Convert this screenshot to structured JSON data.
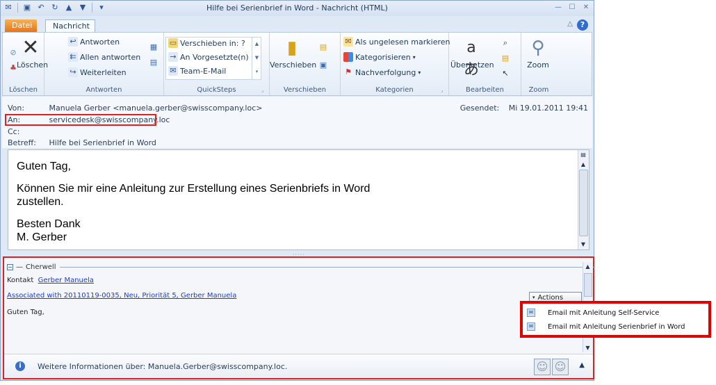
{
  "window": {
    "title": "Hilfe bei Serienbrief in Word - Nachricht (HTML)"
  },
  "tabs": {
    "file": "Datei",
    "message": "Nachricht"
  },
  "ribbon": {
    "delete": {
      "button": "Löschen",
      "group": "Löschen"
    },
    "respond": {
      "reply": "Antworten",
      "reply_all": "Allen antworten",
      "forward": "Weiterleiten",
      "group": "Antworten"
    },
    "quicksteps": {
      "move_to": "Verschieben in: ?",
      "to_manager": "An Vorgesetzte(n)",
      "team_email": "Team-E-Mail",
      "group": "QuickSteps"
    },
    "move": {
      "button": "Verschieben",
      "group": "Verschieben"
    },
    "tags": {
      "mark_unread": "Als ungelesen markieren",
      "categorize": "Kategorisieren",
      "follow_up": "Nachverfolgung",
      "group": "Kategorien"
    },
    "editing": {
      "translate": "Übersetzen",
      "group": "Bearbeiten"
    },
    "zoom": {
      "button": "Zoom",
      "group": "Zoom"
    }
  },
  "header": {
    "from_label": "Von:",
    "from_value": "Manuela Gerber <manuela.gerber@swisscompany.loc>",
    "to_label": "An:",
    "to_value": "servicedesk@swisscompany.loc",
    "cc_label": "Cc:",
    "subject_label": "Betreff:",
    "subject_value": "Hilfe bei Serienbrief in Word",
    "sent_label": "Gesendet:",
    "sent_value": "Mi 19.01.2011 19:41"
  },
  "body": {
    "greeting": "Guten Tag,",
    "line1": "Können Sie mir eine Anleitung zur Erstellung eines Serienbriefs in Word",
    "line2": "zustellen.",
    "closing1": "Besten Dank",
    "closing2": "M. Gerber"
  },
  "addin": {
    "title": "Cherwell",
    "contact_label": "Kontakt",
    "contact_link": "Gerber Manuela",
    "associated_link": "Associated with 20110119-0035, Neu, Priorität 5, Gerber Manuela",
    "actions_button": "Actions",
    "preview": "Guten Tag,",
    "menu_items": [
      "Email mit Anleitung Self-Service",
      "Email mit Anleitung Serienbrief in Word"
    ]
  },
  "people_pane": {
    "info": "Weitere Informationen über: Manuela.Gerber@swisscompany.loc."
  }
}
